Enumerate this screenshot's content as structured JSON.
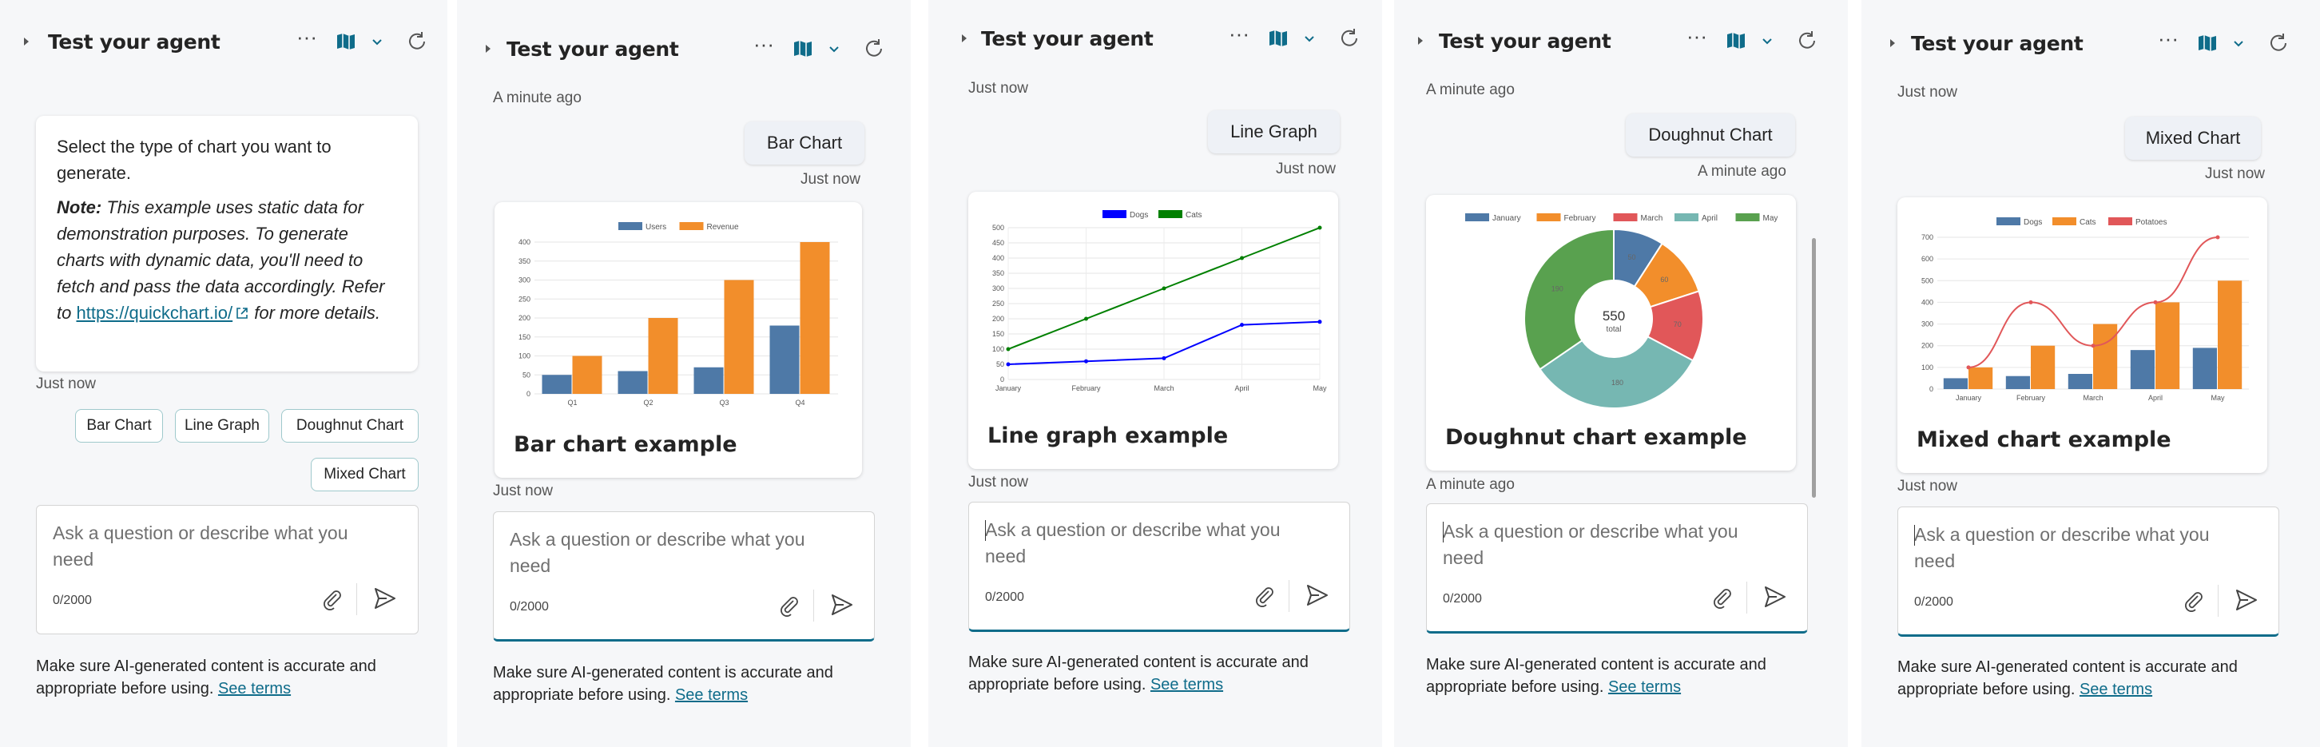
{
  "common": {
    "header_title": "Test your agent",
    "input_placeholder": "Ask a question or describe what you need",
    "counter": "0/2000",
    "disclaimer_text": "Make sure AI-generated content is accurate and appropriate before using.",
    "disclaimer_link": "See terms",
    "accent_color": "#0f6c8a"
  },
  "panel1": {
    "message_intro": "Select the type of chart you want to generate.",
    "note_label": "Note:",
    "note_text": "This example uses static data for demonstration purposes. To generate charts with dynamic data, you'll need to fetch and pass the data accordingly. Refer to",
    "note_link": "https://quickchart.io/",
    "note_tail": "for more details.",
    "timestamp": "Just now",
    "options": [
      "Bar Chart",
      "Line Graph",
      "Doughnut Chart",
      "Mixed Chart"
    ]
  },
  "panel2": {
    "ts_top": "A minute ago",
    "user_message": "Bar Chart",
    "ts_user": "Just now",
    "card_title": "Bar chart example",
    "ts_bottom": "Just now"
  },
  "panel3": {
    "ts_top": "Just now",
    "user_message": "Line Graph",
    "ts_user": "Just now",
    "card_title": "Line graph example",
    "ts_bottom": "Just now"
  },
  "panel4": {
    "ts_top": "A minute ago",
    "user_message": "Doughnut Chart",
    "ts_user": "A minute ago",
    "card_title": "Doughnut chart example",
    "ts_bottom": "A minute ago"
  },
  "panel5": {
    "ts_top": "Just now",
    "user_message": "Mixed Chart",
    "ts_user": "Just now",
    "card_title": "Mixed chart example",
    "ts_bottom": "Just now"
  },
  "chart_data": [
    {
      "type": "bar",
      "categories": [
        "Q1",
        "Q2",
        "Q3",
        "Q4"
      ],
      "series": [
        {
          "name": "Users",
          "values": [
            50,
            60,
            70,
            180
          ],
          "color": "#4e79a7"
        },
        {
          "name": "Revenue",
          "values": [
            100,
            200,
            300,
            400
          ],
          "color": "#f28e2b"
        }
      ],
      "ylim": [
        0,
        400
      ],
      "yticks": [
        0,
        50,
        100,
        150,
        200,
        250,
        300,
        350,
        400
      ]
    },
    {
      "type": "line",
      "categories": [
        "January",
        "February",
        "March",
        "April",
        "May"
      ],
      "series": [
        {
          "name": "Dogs",
          "values": [
            50,
            60,
            70,
            180,
            190
          ],
          "color": "#0000ff"
        },
        {
          "name": "Cats",
          "values": [
            100,
            200,
            300,
            400,
            500
          ],
          "color": "#008000"
        }
      ],
      "ylim": [
        0,
        500
      ],
      "yticks": [
        0,
        50,
        100,
        150,
        200,
        250,
        300,
        350,
        400,
        450,
        500
      ]
    },
    {
      "type": "pie",
      "labels": [
        "January",
        "February",
        "March",
        "April",
        "May"
      ],
      "values": [
        50,
        60,
        70,
        180,
        190
      ],
      "colors": [
        "#4e79a7",
        "#f28e2b",
        "#e15759",
        "#76b7b2",
        "#59a14f"
      ],
      "center_value": "550",
      "center_label": "total"
    },
    {
      "type": "bar",
      "categories": [
        "January",
        "February",
        "March",
        "April",
        "May"
      ],
      "series": [
        {
          "name": "Dogs",
          "values": [
            50,
            60,
            70,
            180,
            190
          ],
          "color": "#4e79a7"
        },
        {
          "name": "Cats",
          "values": [
            100,
            200,
            300,
            400,
            500
          ],
          "color": "#f28e2b"
        },
        {
          "name": "Potatoes",
          "values": [
            100,
            400,
            200,
            400,
            700
          ],
          "color": "#e15759",
          "kind": "line"
        }
      ],
      "ylim": [
        0,
        700
      ],
      "yticks": [
        0,
        100,
        200,
        300,
        400,
        500,
        600,
        700
      ]
    }
  ]
}
